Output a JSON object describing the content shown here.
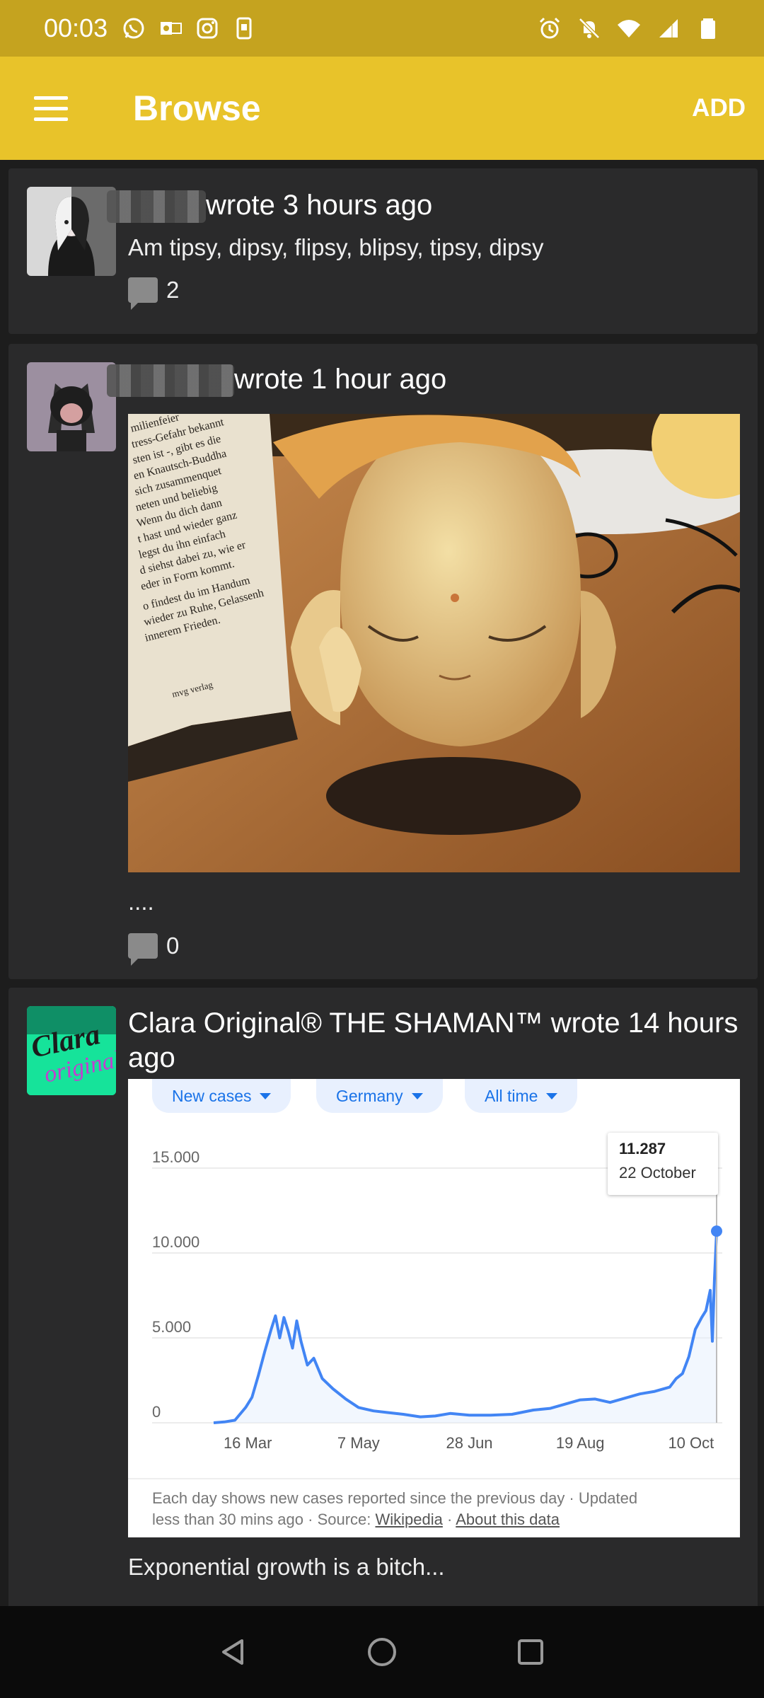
{
  "status_bar": {
    "time": "00:03",
    "left_icons": [
      "whatsapp-icon",
      "outlook-icon",
      "instagram-icon",
      "sim-icon"
    ],
    "right_icons": [
      "alarm-icon",
      "mute-icon",
      "wifi-icon",
      "signal-icon",
      "battery-icon"
    ]
  },
  "app_bar": {
    "title": "Browse",
    "action_label": "ADD"
  },
  "posts": [
    {
      "wrote_text": "wrote 3 hours ago",
      "text": "Am tipsy, dipsy, flipsy, blipsy, tipsy, dipsy",
      "comments": "2"
    },
    {
      "wrote_text": "wrote 1 hour ago",
      "text": "....",
      "comments": "0",
      "book_lines": [
        "milienfeier",
        "tress-Gefahr bekannt",
        "sten ist -, gibt es die",
        "en Knautsch-Buddha",
        "sich zusammenquet",
        "neten und beliebig",
        "Wenn du dich dann",
        "t hast und wieder ganz",
        "legst du ihn einfach",
        "d siehst dabei zu, wie er",
        "eder in Form kommt.",
        "o findest du im Handum",
        "wieder zu Ruhe, Gelassenh",
        "innerem Frieden.",
        "mvg verlag"
      ]
    },
    {
      "author_name": "Clara Original® THE SHAMAN™",
      "wrote_text": "wrote 14 hours ago",
      "avatar_text": "Clara original",
      "text": "Exponential growth is a bitch..."
    }
  ],
  "covid_chart": {
    "filters": [
      "New cases",
      "Germany",
      "All time"
    ],
    "tooltip_value": "11.287",
    "tooltip_date": "22 October",
    "footer_line1": "Each day shows new cases reported since the previous day · Updated",
    "footer_line2_a": "less than 30 mins ago  ·  Source: ",
    "footer_link1": "Wikipedia",
    "footer_sep": " · ",
    "footer_link2": "About this data"
  },
  "chart_data": {
    "type": "line",
    "title": "",
    "xlabel": "",
    "ylabel": "",
    "y_ticks": [
      "0",
      "5.000",
      "10.000",
      "15.000"
    ],
    "x_ticks": [
      "16 Mar",
      "7 May",
      "28 Jun",
      "19 Aug",
      "10 Oct"
    ],
    "ylim": [
      0,
      15000
    ],
    "grid": true,
    "series": [
      {
        "color": "#4285f4",
        "x": [
          "29 Feb",
          "5 Mar",
          "10 Mar",
          "15 Mar",
          "18 Mar",
          "21 Mar",
          "24 Mar",
          "27 Mar",
          "29 Mar",
          "31 Mar",
          "2 Apr",
          "4 Apr",
          "6 Apr",
          "8 Apr",
          "10 Apr",
          "13 Apr",
          "16 Apr",
          "20 Apr",
          "25 Apr",
          "1 May",
          "7 May",
          "14 May",
          "21 May",
          "28 May",
          "5 Jun",
          "12 Jun",
          "19 Jun",
          "28 Jun",
          "8 Jul",
          "18 Jul",
          "28 Jul",
          "5 Aug",
          "12 Aug",
          "19 Aug",
          "26 Aug",
          "2 Sep",
          "9 Sep",
          "16 Sep",
          "23 Sep",
          "30 Sep",
          "3 Oct",
          "6 Oct",
          "9 Oct",
          "12 Oct",
          "15 Oct",
          "17 Oct",
          "19 Oct",
          "20 Oct",
          "21 Oct",
          "22 Oct"
        ],
        "y": [
          0,
          50,
          150,
          900,
          1500,
          2800,
          4200,
          5500,
          6300,
          5000,
          6200,
          5400,
          4400,
          6000,
          4800,
          3400,
          3800,
          2600,
          2000,
          1400,
          900,
          700,
          600,
          500,
          350,
          400,
          550,
          450,
          450,
          500,
          750,
          850,
          1100,
          1350,
          1400,
          1200,
          1450,
          1700,
          1850,
          2100,
          2600,
          2900,
          3900,
          5500,
          6200,
          6600,
          7800,
          4800,
          8500,
          11287
        ]
      }
    ]
  },
  "nav_bar": {
    "icons": [
      "back-icon",
      "home-icon",
      "recents-icon"
    ]
  }
}
